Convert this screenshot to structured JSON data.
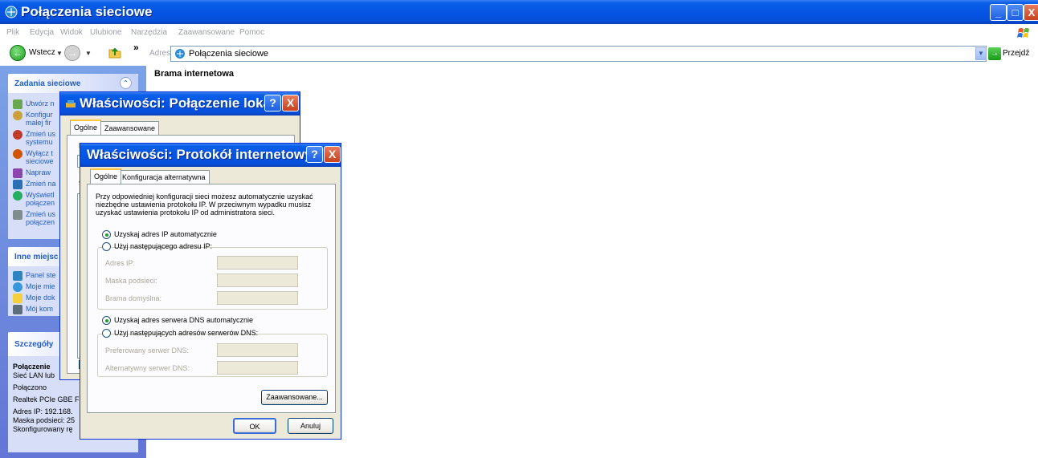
{
  "window": {
    "title": "Połączenia sieciowe",
    "controls": {
      "minimize": "_",
      "maximize": "□",
      "close": "X"
    }
  },
  "menu": [
    "Plik",
    "Edycja",
    "Widok",
    "Ulubione",
    "Narzędzia",
    "Zaawansowane",
    "Pomoc"
  ],
  "toolbar": {
    "back_label": "Wstecz",
    "chevron": "»",
    "address_label": "Adres",
    "address_value": "Połączenia sieciowe",
    "go_label": "Przejdź"
  },
  "taskpane": {
    "network_tasks": {
      "title": "Zadania sieciowe",
      "items": [
        [
          "Utwórz n"
        ],
        [
          "Konfigur",
          "małej fir"
        ],
        [
          "Zmień us",
          "systemu"
        ],
        [
          "Wyłącz t",
          "sieciowe"
        ],
        [
          "Napraw"
        ],
        [
          "Zmień na"
        ],
        [
          "Wyświetl",
          "połączen"
        ],
        [
          "Zmień us",
          "połączen"
        ]
      ]
    },
    "other_places": {
      "title": "Inne miejsc",
      "items": [
        "Panel ste",
        "Moje mie",
        "Moje dok",
        "Mój kom"
      ]
    },
    "details": {
      "title": "Szczegóły",
      "lines": [
        "Połączenie",
        "Sieć LAN lub",
        "Połączono",
        "Realtek PCIe GBE F",
        "Adres IP: 192.168.",
        "Maska podsieci: 25",
        "Skonfigurowany rę"
      ]
    }
  },
  "content": {
    "heading": "Brama internetowa"
  },
  "dialog_connection": {
    "title": "Właściwości: Połączenie loka...",
    "tabs": [
      "Ogólne",
      "Zaawansowane"
    ],
    "fragment_label": "Po",
    "fragment_t": "T"
  },
  "dialog_tcpip": {
    "title": "Właściwości: Protokół internetowy...",
    "tabs": [
      "Ogólne",
      "Konfiguracja alternatywna"
    ],
    "description": [
      "Przy odpowiedniej konfiguracji sieci możesz automatycznie uzyskać",
      "niezbędne ustawienia protokołu IP. W przeciwnym wypadku musisz",
      "uzyskać ustawienia protokołu IP od administratora sieci."
    ],
    "ip_auto": "Uzyskaj adres IP automatycznie",
    "ip_manual": "Użyj następującego adresu IP:",
    "ip_fields": [
      "Adres IP:",
      "Maska podsieci:",
      "Brama domyślna:"
    ],
    "dns_auto": "Uzyskaj adres serwera DNS automatycznie",
    "dns_manual": "Użyj następujących adresów serwerów DNS:",
    "dns_fields": [
      "Preferowany serwer DNS:",
      "Alternatywny serwer DNS:"
    ],
    "advanced_button": "Zaawansowane...",
    "ok_button": "OK",
    "cancel_button": "Anuluj",
    "help_glyph": "?",
    "close_glyph": "X"
  }
}
